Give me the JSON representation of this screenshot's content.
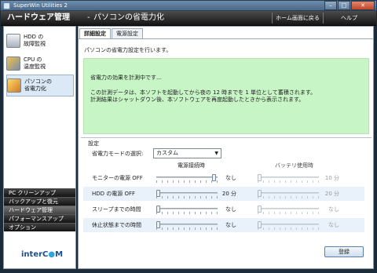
{
  "window": {
    "title": "SuperWin Utilities 2",
    "close_label": "✕"
  },
  "header": {
    "section_title": "ハードウェア管理",
    "separator": "-",
    "subtitle": "パソコンの省電力化",
    "home_link": "ホーム画面に戻る",
    "help_link": "ヘルプ"
  },
  "sidebar": {
    "items": [
      {
        "line1": "HDD の",
        "line2": "故障監視",
        "icon": "hdd-icon"
      },
      {
        "line1": "CPU の",
        "line2": "温度監視",
        "icon": "cpu-icon"
      },
      {
        "line1": "パソコンの",
        "line2": "省電力化",
        "icon": "power-icon"
      }
    ],
    "menu": [
      "PC クリーンアップ",
      "バックアップと復元",
      "ハードウェア管理",
      "パフォーマンスアップ",
      "オプション"
    ],
    "logo_a": "inter",
    "logo_b": "C",
    "logo_c": "M"
  },
  "tabs": [
    "詳細設定",
    "電源設定"
  ],
  "main": {
    "intro": "パソコンの省電力設定を行います。",
    "notice_line1": "省電力の効果を計測中です…",
    "notice_line2": "この計測データは、本ソフトを起動してから夜の 12 時までを 1 単位として蓄積されます。",
    "notice_line3": "計測結果はシャットダウン後、本ソフトウェアを再度起動したときから表示されます。"
  },
  "settings": {
    "legend": "設定",
    "mode_label": "省電力モードの選択:",
    "mode_value": "カスタム",
    "col_ac": "電源接続時",
    "col_battery": "バッテリ使用時",
    "rows": [
      {
        "label": "モニターの電源 OFF",
        "ac": "なし",
        "battery": "10 分",
        "ac_level": 1.0,
        "battery_level": 0.0
      },
      {
        "label": "HDD の電源 OFF",
        "ac": "20 分",
        "battery": "20 分",
        "ac_level": 0.0,
        "battery_level": 0.0
      },
      {
        "label": "スリープまでの時間",
        "ac": "なし",
        "battery": "なし",
        "ac_level": 0.0,
        "battery_level": 0.0
      },
      {
        "label": "休止状態までの時間",
        "ac": "なし",
        "battery": "なし",
        "ac_level": 0.0,
        "battery_level": 0.0
      }
    ]
  },
  "buttons": {
    "register": "登録"
  },
  "colors": {
    "notice_bg": "#c7f5c6",
    "header_bg": "#1a1a1a",
    "accent_blue": "#1c4f8c"
  }
}
